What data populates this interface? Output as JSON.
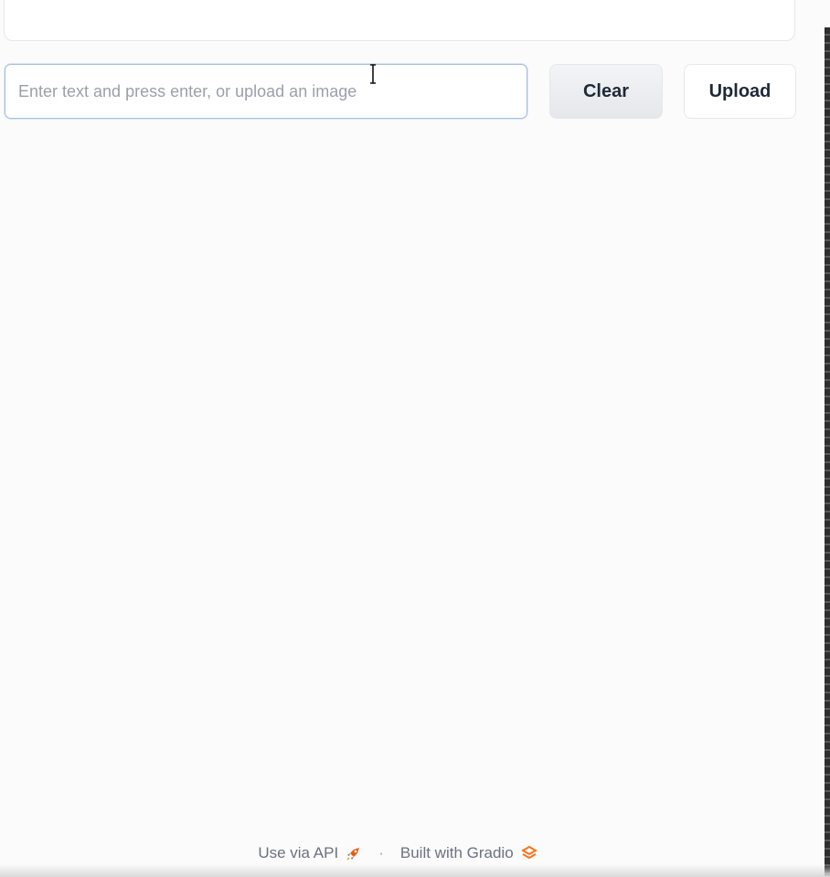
{
  "chat": {
    "input_placeholder": "Enter text and press enter, or upload an image",
    "input_value": ""
  },
  "buttons": {
    "clear_label": "Clear",
    "upload_label": "Upload"
  },
  "footer": {
    "api_label": "Use via API",
    "separator": "·",
    "built_with_label": "Built with Gradio",
    "api_icon": "rocket-icon",
    "gradio_icon": "gradio-logo-icon",
    "accent_color": "#f97316"
  }
}
